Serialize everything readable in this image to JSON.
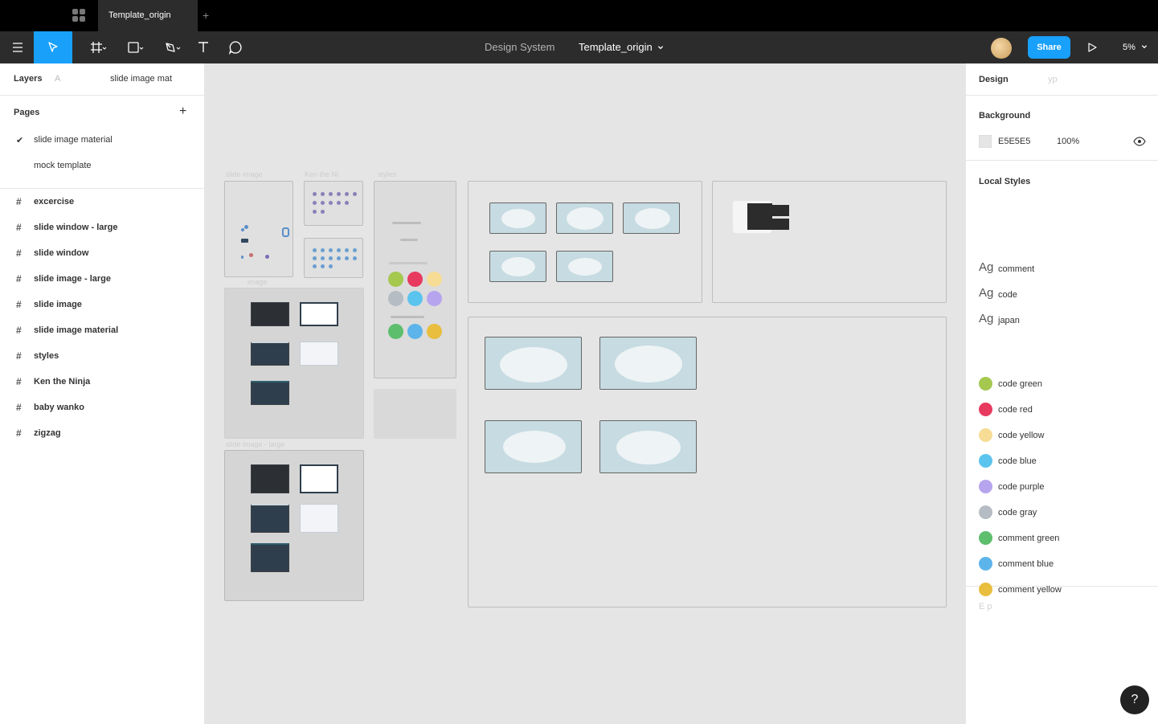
{
  "titlebar": {
    "tab_title": "Template_origin",
    "new_tab_label": "+"
  },
  "toolbar": {
    "project_name": "Design System",
    "file_name": "Template_origin",
    "share_label": "Share",
    "zoom_label": "5%",
    "tools": [
      "menu-icon",
      "move-icon",
      "frame-icon",
      "rectangle-icon",
      "pen-icon",
      "text-icon",
      "comment-icon"
    ],
    "accent_color": "#18a0fb"
  },
  "left_panel": {
    "tab_layers": "Layers",
    "tab_assets": "A",
    "page_selector": "slide image mat",
    "pages_title": "Pages",
    "add_page_icon": "+",
    "pages": [
      {
        "label": "slide image material",
        "selected": true
      },
      {
        "label": "mock template",
        "selected": false
      }
    ],
    "layers": [
      "excercise",
      "slide window - large",
      "slide window",
      "slide image - large",
      "slide image",
      "slide image material",
      "styles",
      "Ken the Ninja",
      "baby wanko",
      "zigzag"
    ]
  },
  "canvas": {
    "background": "#e5e5e5",
    "frame_labels": [
      "slide image",
      "Ken the Nl",
      "styles",
      "image",
      "slide image - large"
    ]
  },
  "right_panel": {
    "tab_design": "Design",
    "tab_prototype": "yp",
    "background_title": "Background",
    "background_hex": "E5E5E5",
    "background_opacity": "100%",
    "local_styles_title": "Local Styles",
    "text_styles": [
      {
        "sample": "Ag",
        "name": "comment"
      },
      {
        "sample": "Ag",
        "name": "code"
      },
      {
        "sample": "Ag",
        "name": "japan"
      }
    ],
    "color_styles": [
      {
        "name": "code green",
        "color": "#a5c84f"
      },
      {
        "name": "code red",
        "color": "#e83a5f"
      },
      {
        "name": "code yellow",
        "color": "#f6dc95"
      },
      {
        "name": "code blue",
        "color": "#5bc4ee"
      },
      {
        "name": "code purple",
        "color": "#b7a4ee"
      },
      {
        "name": "code gray",
        "color": "#b6bcc4"
      },
      {
        "name": "comment green",
        "color": "#5dbe6d"
      },
      {
        "name": "comment blue",
        "color": "#5cb4ea"
      },
      {
        "name": "comment yellow",
        "color": "#e9bd3d"
      }
    ],
    "export_title": "E p"
  },
  "help_label": "?"
}
